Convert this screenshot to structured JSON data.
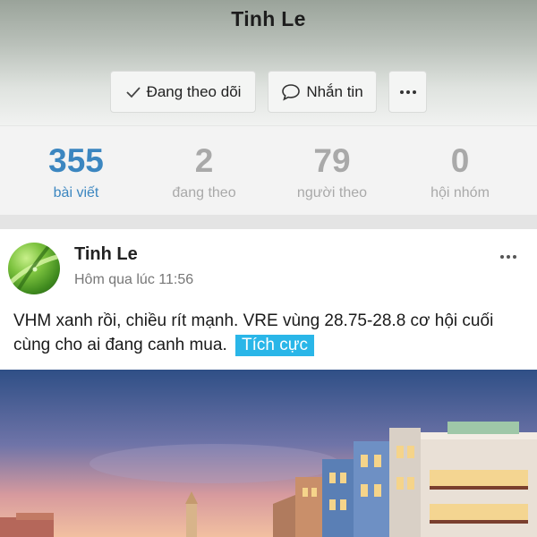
{
  "profile": {
    "name": "Tinh Le",
    "following_button": "Đang theo dõi",
    "message_button": "Nhắn tin",
    "more_icon": "ellipsis-icon"
  },
  "stats": [
    {
      "value": "355",
      "label": "bài viết",
      "active": true
    },
    {
      "value": "2",
      "label": "đang theo",
      "active": false
    },
    {
      "value": "79",
      "label": "người theo",
      "active": false
    },
    {
      "value": "0",
      "label": "hội nhóm",
      "active": false
    }
  ],
  "post": {
    "author": "Tinh Le",
    "time": "Hôm qua lúc 11:56",
    "text": "VHM xanh rồi, chiều rít mạnh. VRE vùng 28.75-28.8 cơ hội cuối cùng cho ai đang canh mua.",
    "tag": "Tích cực"
  },
  "colors": {
    "accent": "#3b86c0",
    "tag_background": "#2ab6e8",
    "muted": "#a9a9a9"
  }
}
